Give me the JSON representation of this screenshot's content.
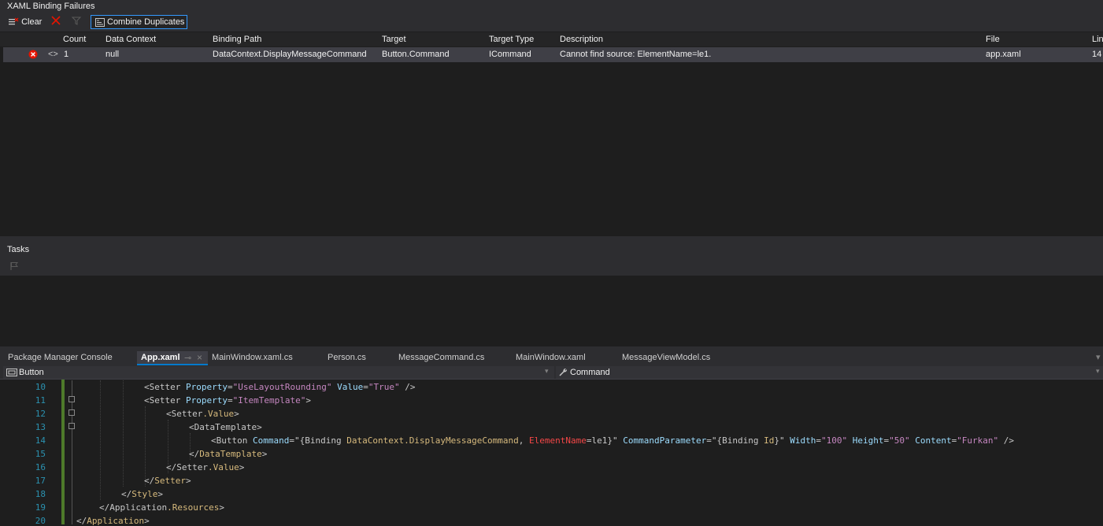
{
  "xaml_binding_failures": {
    "title": "XAML Binding Failures",
    "toolbar": {
      "clear_label": "Clear",
      "combine_duplicates_label": "Combine Duplicates"
    },
    "columns": [
      "Count",
      "Data Context",
      "Binding Path",
      "Target",
      "Target Type",
      "Description",
      "File",
      "Lin"
    ],
    "rows": [
      {
        "count": "1",
        "data_context": "null",
        "binding_path": "DataContext.DisplayMessageCommand",
        "target": "Button.Command",
        "target_type": "ICommand",
        "description": "Cannot find source: ElementName=le1.",
        "file": "app.xaml",
        "line": "14"
      }
    ]
  },
  "tasks": {
    "title": "Tasks"
  },
  "editor_tabs": [
    {
      "label": "Package Manager Console"
    },
    {
      "label": "App.xaml",
      "active": true
    },
    {
      "label": "MainWindow.xaml.cs"
    },
    {
      "label": "Person.cs"
    },
    {
      "label": "MessageCommand.cs"
    },
    {
      "label": "MainWindow.xaml"
    },
    {
      "label": "MessageViewModel.cs"
    }
  ],
  "navigation_bar": {
    "left": "Button",
    "right": "Command"
  },
  "code_lines": [
    {
      "number": "10",
      "text": "<Setter Property=\"UseLayoutRounding\" Value=\"True\" />"
    },
    {
      "number": "11",
      "text": "<Setter Property=\"ItemTemplate\">"
    },
    {
      "number": "12",
      "text": "<Setter.Value>"
    },
    {
      "number": "13",
      "text": "<DataTemplate>"
    },
    {
      "number": "14",
      "text": "<Button Command=\"{Binding DataContext.DisplayMessageCommand, ElementName=le1}\" CommandParameter=\"{Binding Id}\" Width=\"100\" Height=\"50\" Content=\"Furkan\" />"
    },
    {
      "number": "15",
      "text": "</DataTemplate>"
    },
    {
      "number": "16",
      "text": "</Setter.Value>"
    },
    {
      "number": "17",
      "text": "</Setter>"
    },
    {
      "number": "18",
      "text": "</Style>"
    },
    {
      "number": "19",
      "text": "</Application.Resources>"
    },
    {
      "number": "20",
      "text": "</Application>"
    }
  ],
  "colors": {
    "error": "#e51400",
    "accent": "#007acc",
    "change_bar": "#4e7a2a"
  }
}
